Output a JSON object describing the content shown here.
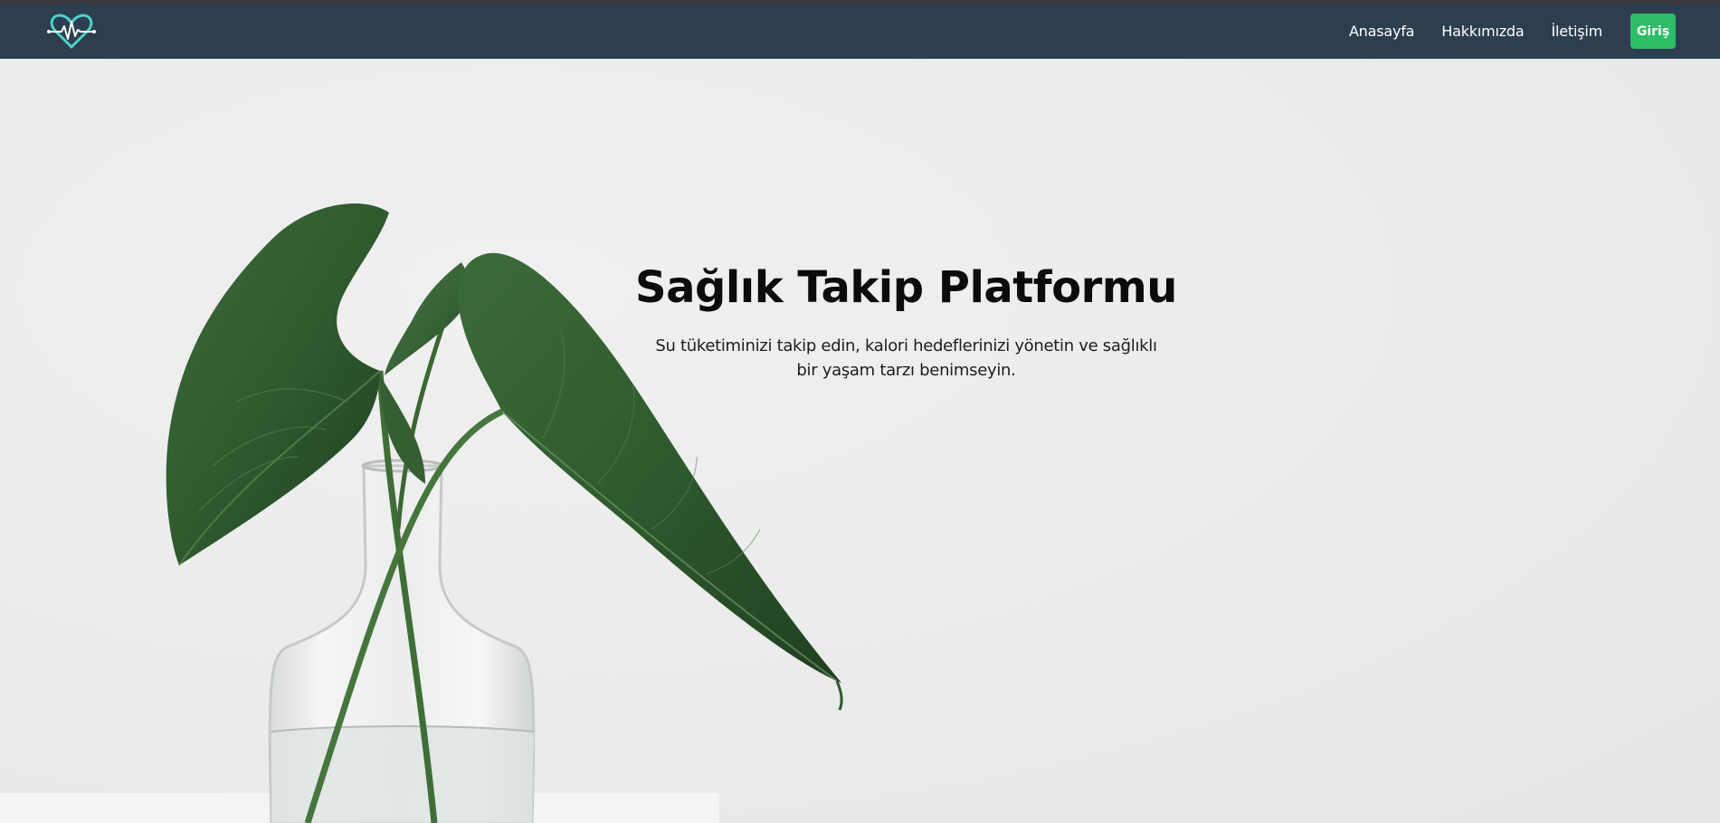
{
  "nav": {
    "links": [
      "Anasayfa",
      "Hakkımızda",
      "İletişim"
    ],
    "login_label": "Giriş"
  },
  "hero": {
    "title": "Sağlık Takip Platformu",
    "subtitle": "Su tüketiminizi takip edin, kalori hedeflerinizi yönetin ve sağlıklı bir yaşam tarzı benimseyin."
  },
  "colors": {
    "navbar": "#2c3e50",
    "login_button": "#2ebd67",
    "logo_accent": "#4fd1c5",
    "background": "#ececec"
  },
  "icons": {
    "logo": "heart-pulse-icon"
  }
}
